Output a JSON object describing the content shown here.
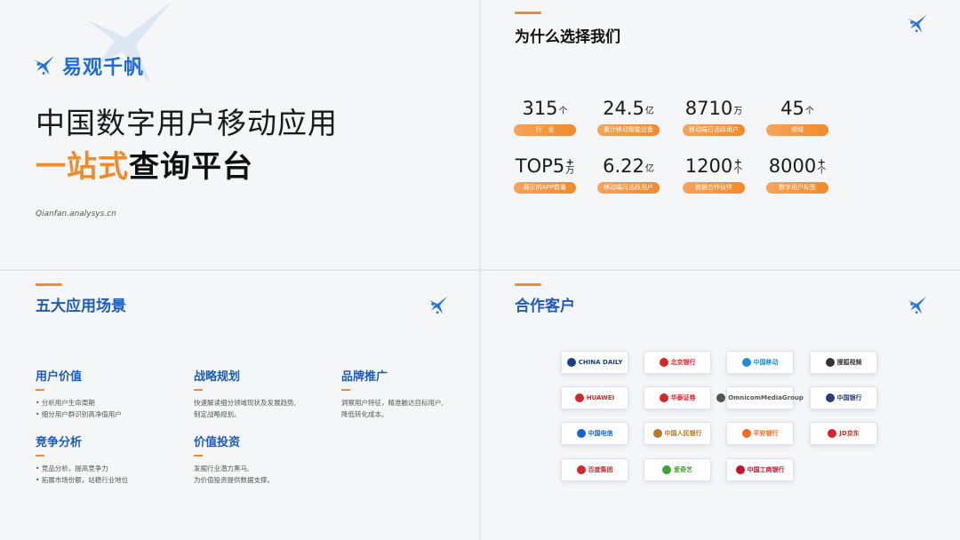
{
  "panel1": {
    "brand_name": "易观千帆",
    "headline_line1": "中国数字用户移动应用",
    "headline_highlight": "一站式",
    "headline_rest": "查询平台",
    "url": "Qianfan.analysys.cn"
  },
  "panel2": {
    "title": "为什么选择我们",
    "stats": [
      {
        "value": "315",
        "unit": "个",
        "plus": "",
        "label": "行　业"
      },
      {
        "value": "24.5",
        "unit": "亿",
        "plus": "",
        "label": "累计移动智能设备"
      },
      {
        "value": "8710",
        "unit": "万",
        "plus": "",
        "label": "移动端日活跃用户"
      },
      {
        "value": "45",
        "unit": "个",
        "plus": "",
        "label": "领域"
      },
      {
        "value": "TOP5",
        "unit": "万",
        "plus": "+",
        "label": "展示的APP数量"
      },
      {
        "value": "6.22",
        "unit": "亿",
        "plus": "",
        "label": "移动端月活跃用户"
      },
      {
        "value": "1200",
        "unit": "个",
        "plus": "+",
        "label": "数据合作伙伴"
      },
      {
        "value": "8000",
        "unit": "个",
        "plus": "+",
        "label": "数字用户标签"
      }
    ]
  },
  "panel3": {
    "title": "五大应用场景",
    "scenarios": [
      {
        "title": "用户价值",
        "lines": [
          "•  分析用户生命周期",
          "•  细分用户群识别高净值用户"
        ]
      },
      {
        "title": "战略规划",
        "lines": [
          "快速解读细分领域现状及发展趋势,",
          "制定战略规划。"
        ]
      },
      {
        "title": "品牌推广",
        "lines": [
          "洞察用户特征，精准触达目标用户,",
          "降低转化成本。"
        ]
      },
      {
        "title": "竞争分析",
        "lines": [
          "•  竞品分析，提高竞争力",
          "•  拓展市场份额，站稳行业地位"
        ]
      },
      {
        "title": "价值投资",
        "lines": [
          "发掘行业潜力黑马,",
          "为价值投资提供数据支撑。"
        ]
      }
    ]
  },
  "panel4": {
    "title": "合作客户",
    "clients": [
      {
        "name": "CHINA DAILY",
        "color": "#1c3e8a"
      },
      {
        "name": "北京银行",
        "color": "#d8252b"
      },
      {
        "name": "中国移动",
        "color": "#1a8ed6"
      },
      {
        "name": "搜狐视频",
        "color": "#333333"
      },
      {
        "name": "HUAWEI",
        "color": "#d8252b"
      },
      {
        "name": "华泰证券",
        "color": "#d8252b"
      },
      {
        "name": "OmnicomMediaGroup",
        "color": "#555555"
      },
      {
        "name": "中国银行",
        "color": "#2a3d7a"
      },
      {
        "name": "中国电信",
        "color": "#1a63c7"
      },
      {
        "name": "中国人民银行",
        "color": "#b5792a"
      },
      {
        "name": "平安银行",
        "color": "#f06a1c"
      },
      {
        "name": "JD京东",
        "color": "#d8252b"
      },
      {
        "name": "百度集团",
        "color": "#d8252b"
      },
      {
        "name": "爱奇艺",
        "color": "#3aa52e"
      },
      {
        "name": "中国工商银行",
        "color": "#c8102e"
      }
    ]
  },
  "colors": {
    "brand_blue": "#1d6cd6",
    "accent_orange": "#f18a2a"
  },
  "icons": {
    "logo": "kite-bird-icon"
  }
}
